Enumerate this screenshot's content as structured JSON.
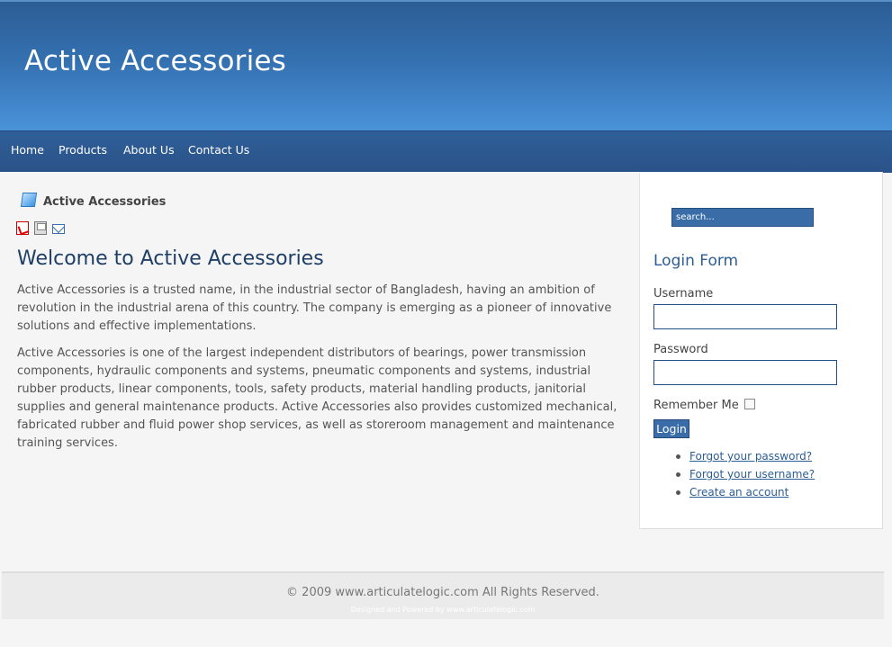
{
  "header": {
    "site_title": "Active Accessories"
  },
  "nav": {
    "items": [
      "Home",
      "Products",
      "About Us",
      "Contact Us"
    ]
  },
  "breadcrumb": {
    "label": "Active Accessories"
  },
  "article": {
    "icons": [
      "pdf-icon",
      "print-icon",
      "email-icon"
    ],
    "title": "Welcome to Active Accessories",
    "paragraphs": [
      "Active Accessories is a trusted name, in the industrial sector of Bangladesh, having an ambition of revolution in the industrial arena of this country. The company is emerging as a pioneer of innovative solutions and effective implementations.",
      "Active Accessories is one of the largest independent distributors of bearings, power transmission components, hydraulic components and systems, pneumatic components and systems, industrial rubber products, linear components, tools, safety products, material handling products, janitorial supplies and general maintenance products. Active Accessories also provides customized mechanical, fabricated rubber and fluid power shop services, as well as storeroom management and maintenance training services."
    ]
  },
  "sidebar": {
    "search_placeholder": "search...",
    "login": {
      "title": "Login Form",
      "username_label": "Username",
      "username_value": "",
      "password_label": "Password",
      "password_value": "",
      "remember_label": "Remember Me",
      "remember_checked": false,
      "button_label": "Login",
      "links": [
        "Forgot your password?",
        "Forgot your username?",
        "Create an account"
      ]
    }
  },
  "footer": {
    "copyright": "© 2009 www.articulatelogic.com All Rights Reserved.",
    "powered": "Designed and Powered by www.articulatelogic.com"
  },
  "colors": {
    "header": "#3470b0",
    "nav": "#2c5a92",
    "accent": "#3a6da8",
    "heading": "#1f3f66"
  }
}
